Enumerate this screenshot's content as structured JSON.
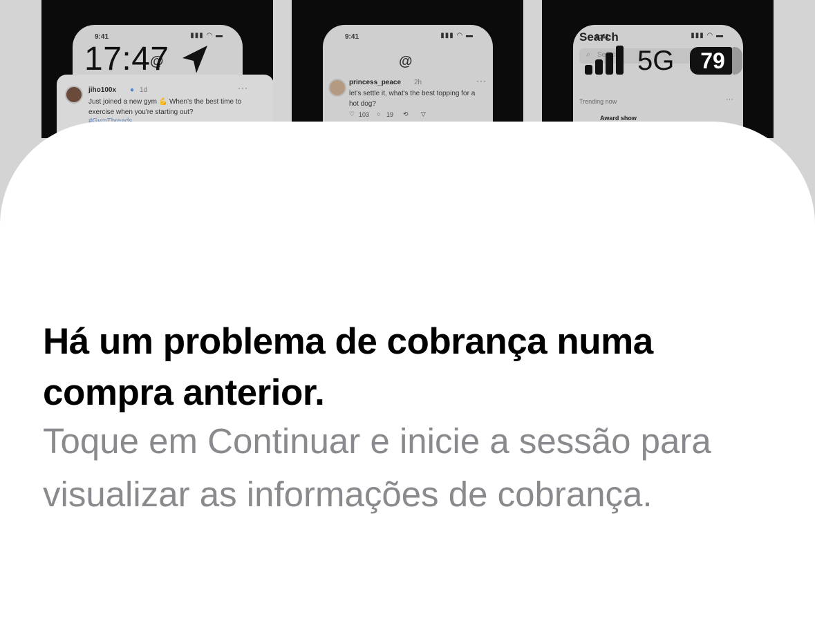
{
  "status_bar": {
    "time": "17:47",
    "network": "5G",
    "battery": "79"
  },
  "background_screens": {
    "phone_time": "9:41",
    "post1": {
      "username": "jiho100x",
      "time": "1d",
      "text": "Just joined a new gym 💪 When's the best time to exercise when you're starting out?",
      "link": "#GymThreads"
    },
    "post2": {
      "username": "princess_peace",
      "time": "2h",
      "text": "let's settle it, what's the best topping for a hot dog?",
      "likes": "103",
      "replies": "19"
    },
    "search_screen": {
      "title": "Search",
      "search_placeholder": "Search",
      "trending_label": "Trending now",
      "trend_item": "Award show"
    }
  },
  "dialog": {
    "title": "Há um problema de cobrança numa compra anterior.",
    "message": "Toque em Continuar e inicie a sessão para visualizar as informações de cobrança."
  }
}
